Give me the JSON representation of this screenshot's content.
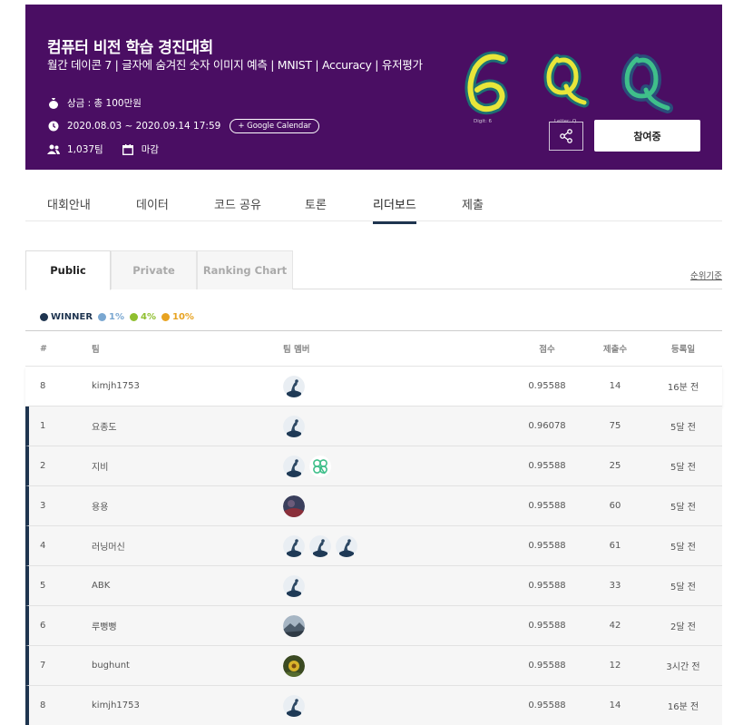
{
  "banner": {
    "title": "컴퓨터 비전 학습 경진대회",
    "subtitle": "월간 데이콘 7 | 글자에 숨겨진 숫자 이미지 예측 | MNIST | Accuracy | 유저평가",
    "prize": "상금 : 총 100만원",
    "dates": "2020.08.03 ~ 2020.09.14 17:59",
    "calendar_button": "+ Google Calendar",
    "teams": "1,037팀",
    "status": "마감",
    "digit_caption": "Digit: 6",
    "letter_caption": "Letter: Q",
    "join_button": "참여중",
    "bg_color": "#4a0e63"
  },
  "nav_tabs": [
    {
      "label": "대회안내"
    },
    {
      "label": "데이터"
    },
    {
      "label": "코드 공유"
    },
    {
      "label": "토론"
    },
    {
      "label": "리더보드",
      "active": true
    },
    {
      "label": "제출"
    }
  ],
  "sub_tabs": {
    "public": "Public",
    "private": "Private",
    "ranking_chart": "Ranking Chart",
    "active": "Public"
  },
  "rank_criteria": "순위기준",
  "legend": [
    {
      "label": "WINNER",
      "color": "#1f3550"
    },
    {
      "label": "1%",
      "color": "#7aa7d1"
    },
    {
      "label": "4%",
      "color": "#8fbf2f"
    },
    {
      "label": "10%",
      "color": "#e8a321"
    }
  ],
  "table": {
    "headers": {
      "rank": "#",
      "team": "팀",
      "members": "팀 멤버",
      "score": "점수",
      "count": "제출수",
      "date": "등록일"
    },
    "my_row": {
      "rank": "8",
      "team": "kimjh1753",
      "avatars": [
        "diver"
      ],
      "score": "0.95588",
      "count": "14",
      "date": "16분 전"
    },
    "rows": [
      {
        "rank": "1",
        "team": "요종도",
        "avatars": [
          "diver"
        ],
        "score": "0.96078",
        "count": "75",
        "date": "5달 전"
      },
      {
        "rank": "2",
        "team": "지비",
        "avatars": [
          "diver",
          "clover"
        ],
        "score": "0.95588",
        "count": "25",
        "date": "5달 전"
      },
      {
        "rank": "3",
        "team": "용용",
        "avatars": [
          "photo-dark"
        ],
        "score": "0.95588",
        "count": "60",
        "date": "5달 전"
      },
      {
        "rank": "4",
        "team": "러닝머신",
        "avatars": [
          "diver",
          "diver",
          "diver"
        ],
        "score": "0.95588",
        "count": "61",
        "date": "5달 전"
      },
      {
        "rank": "5",
        "team": "ABK",
        "avatars": [
          "diver"
        ],
        "score": "0.95588",
        "count": "33",
        "date": "5달 전"
      },
      {
        "rank": "6",
        "team": "루뻥뻥",
        "avatars": [
          "photo-mountain"
        ],
        "score": "0.95588",
        "count": "42",
        "date": "2달 전"
      },
      {
        "rank": "7",
        "team": "bughunt",
        "avatars": [
          "photo-flower"
        ],
        "score": "0.95588",
        "count": "12",
        "date": "3시간 전"
      },
      {
        "rank": "8",
        "team": "kimjh1753",
        "avatars": [
          "diver"
        ],
        "score": "0.95588",
        "count": "14",
        "date": "16분 전"
      }
    ]
  }
}
